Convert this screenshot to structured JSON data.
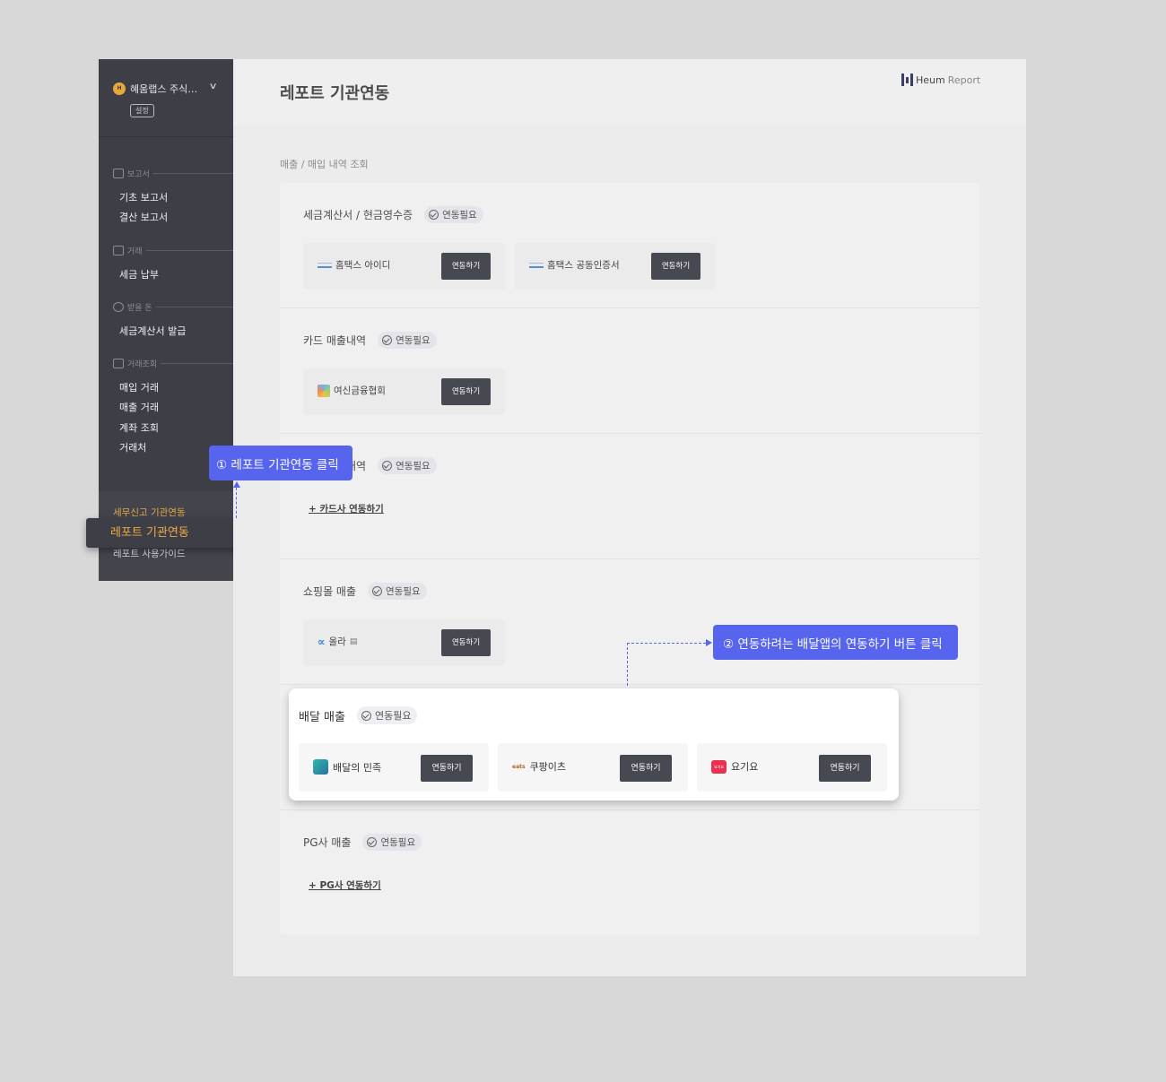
{
  "sidebar": {
    "company_name": "혜움랩스 주식…",
    "company_logo_text": "H",
    "settings_label": "설정",
    "sections": [
      {
        "title": "보고서",
        "items": [
          "기초 보고서",
          "결산 보고서"
        ]
      },
      {
        "title": "거래",
        "items": [
          "세금 납부"
        ]
      },
      {
        "title": "받을 돈",
        "items": [
          "세금계산서 발급"
        ]
      },
      {
        "title": "거래조회",
        "items": [
          "매입 거래",
          "매출 거래",
          "계좌 조회",
          "거래처"
        ]
      }
    ],
    "bottom_links": [
      "세무신고 기관연동",
      "레포트 기관연동",
      "레포트 사용가이드"
    ]
  },
  "header": {
    "title": "레포트 기관연동",
    "brand_heum": "Heum",
    "brand_report": "Report"
  },
  "breadcrumb": "매출 / 매입 내역 조회",
  "sections": [
    {
      "label": "세금계산서 / 현금영수증",
      "badge": "연동필요",
      "cards": [
        {
          "name": "홈택스 아이디",
          "button": "연동하기"
        },
        {
          "name": "홈택스 공동인증서",
          "button": "연동하기"
        }
      ]
    },
    {
      "label": "카드 매출내역",
      "badge": "연동필요",
      "cards": [
        {
          "name": "여신금융협회",
          "button": "연동하기"
        }
      ]
    },
    {
      "label": "카드 매입내역",
      "badge": "연동필요",
      "add_link": "+ 카드사 연동하기"
    },
    {
      "label": "쇼핑몰 매출",
      "badge": "연동필요",
      "cards": [
        {
          "name": "올라",
          "button": "연동하기"
        }
      ]
    },
    {
      "label": "PG사 매출",
      "badge": "연동필요",
      "add_link": "+ PG사 연동하기"
    }
  ],
  "delivery": {
    "label": "배달 매출",
    "badge": "연동필요",
    "cards": [
      {
        "name": "배달의 민족",
        "button": "연동하기"
      },
      {
        "name": "쿠팡이츠",
        "logo_text": "eats",
        "button": "연동하기"
      },
      {
        "name": "요기요",
        "logo_text": "요기요",
        "button": "연동하기"
      }
    ]
  },
  "callouts": {
    "step1": "① 레포트 기관연동 클릭",
    "step2": "② 연동하려는 배달앱의 연동하기 버튼 클릭"
  },
  "colors": {
    "accent": "#5664ee",
    "sidebar_bg": "#3d3e46",
    "active_link": "#f0a948"
  }
}
